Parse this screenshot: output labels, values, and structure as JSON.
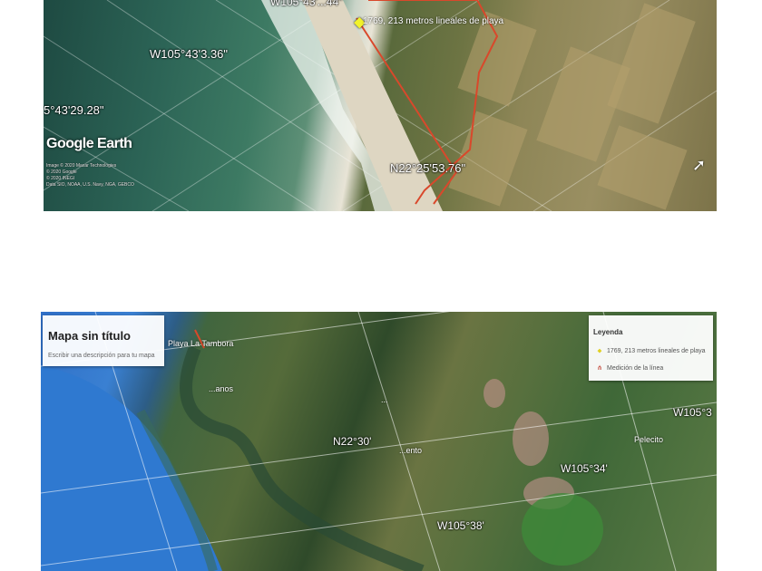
{
  "top_map": {
    "coord_top_partial": "W105°43'...44\"",
    "coord_w_1": "W105°43'3.36\"",
    "coord_w_2": "5°43'29.28\"",
    "coord_n": "N22°25'53.76\"",
    "measurement_label": "1769, 213 metros lineales de playa",
    "logo": "Google Earth",
    "attribution": "Image © 2020 Maxar Technologies\n© 2020 Google\n© 2020 INEGI\nData SIO, NOAA, U.S. Navy, NGA, GEBCO",
    "pin_icon": "yellow-pushpin-icon",
    "cursor_icon": "mouse-pointer-icon"
  },
  "bottom_map": {
    "title": "Mapa sin título",
    "description": "Escribir una descripción para tu mapa",
    "legend_title": "Leyenda",
    "legend_items": [
      {
        "icon": "yellow-pushpin-icon",
        "label": "1769, 213 metros lineales de playa"
      },
      {
        "icon": "ruler-icon",
        "label": "Medición de la línea"
      }
    ],
    "place_playa": "Playa La Tambora",
    "place_a": "...anos",
    "place_b": "...",
    "place_c": "...ento",
    "place_d": "Pelecito",
    "coord_n": "N22°30'",
    "coord_w34": "W105°34'",
    "coord_w38": "W105°38'",
    "coord_w3x": "W105°3"
  }
}
